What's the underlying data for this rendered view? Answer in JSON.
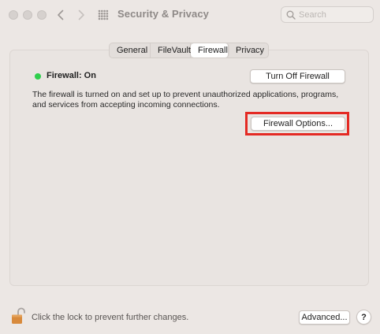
{
  "window": {
    "title": "Security & Privacy"
  },
  "toolbar": {
    "back_icon": "chevron-left-icon",
    "forward_icon": "chevron-right-icon",
    "grid_icon": "grid-icon",
    "search_placeholder": "Search",
    "search_value": ""
  },
  "tabs": [
    {
      "label": "General",
      "active": false
    },
    {
      "label": "FileVault",
      "active": false
    },
    {
      "label": "Firewall",
      "active": true
    },
    {
      "label": "Privacy",
      "active": false
    }
  ],
  "firewall": {
    "status_label": "Firewall: On",
    "status_color": "#2fcf4c",
    "turn_off_label": "Turn Off Firewall",
    "description": "The firewall is turned on and set up to prevent unauthorized applications, programs, and services from accepting incoming connections.",
    "options_label": "Firewall Options..."
  },
  "footer": {
    "lock_text": "Click the lock to prevent further changes.",
    "advanced_label": "Advanced...",
    "help_label": "?"
  },
  "colors": {
    "highlight": "#e42a24",
    "lock": "#d88a3c"
  }
}
